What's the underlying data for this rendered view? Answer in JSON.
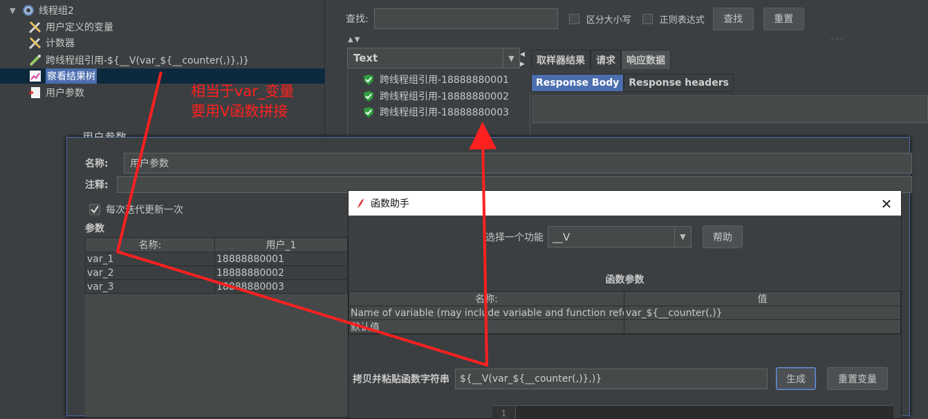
{
  "tree": {
    "items": [
      {
        "label": "线程组2",
        "icon": "gear-icon"
      },
      {
        "label": "用户定义的变量",
        "icon": "wrench-icon"
      },
      {
        "label": "计数器",
        "icon": "wrench-icon"
      },
      {
        "label": "跨线程组引用-${__V(var_${__counter(,)},)}",
        "icon": "sampler-icon"
      },
      {
        "label": "察看结果树",
        "icon": "chart-icon"
      },
      {
        "label": "用户参数",
        "icon": "document-icon"
      }
    ]
  },
  "search": {
    "label": "查找:",
    "value": "",
    "case_label": "区分大小写",
    "regex_label": "正则表达式",
    "find_button": "查找",
    "reset_button": "重置"
  },
  "renderer": {
    "selected": "Text"
  },
  "results": {
    "items": [
      {
        "label": "跨线程组引用-18888880001",
        "status": "success"
      },
      {
        "label": "跨线程组引用-18888880002",
        "status": "success"
      },
      {
        "label": "跨线程组引用-18888880003",
        "status": "success"
      }
    ]
  },
  "result_tabs": [
    "取样器结果",
    "请求",
    "响应数据"
  ],
  "response_tabs": [
    "Response Body",
    "Response headers"
  ],
  "user_params": {
    "title": "用户参数",
    "name_label": "名称:",
    "name_value": "用户参数",
    "comment_label": "注释:",
    "comment_value": "",
    "update_once_label": "每次迭代更新一次",
    "update_once_checked": true,
    "params_label": "参数",
    "table": {
      "headers": [
        "名称:",
        "用户_1"
      ],
      "rows": [
        [
          "var_1",
          "18888880001"
        ],
        [
          "var_2",
          "18888880002"
        ],
        [
          "var_3",
          "18888880003"
        ]
      ]
    }
  },
  "function_helper": {
    "title": "函数助手",
    "choose_label": "选择一个功能",
    "selected_function": "__V",
    "help_button": "帮助",
    "params_label": "函数参数",
    "table": {
      "headers": [
        "名称:",
        "值"
      ],
      "rows": [
        [
          "Name of variable (may include variable and function references)",
          "var_${__counter(,)}"
        ],
        [
          "默认值",
          ""
        ]
      ]
    },
    "copy_label": "拷贝并粘贴函数字符串",
    "copy_value": "${__V(var_${__counter(,)},)}",
    "generate_button": "生成",
    "reset_vars_button": "重置变量",
    "editor_line": "1"
  },
  "annotation": {
    "line1": "相当于var_变量",
    "line2": "要用V函数拼接",
    "color": "#ff2020"
  }
}
